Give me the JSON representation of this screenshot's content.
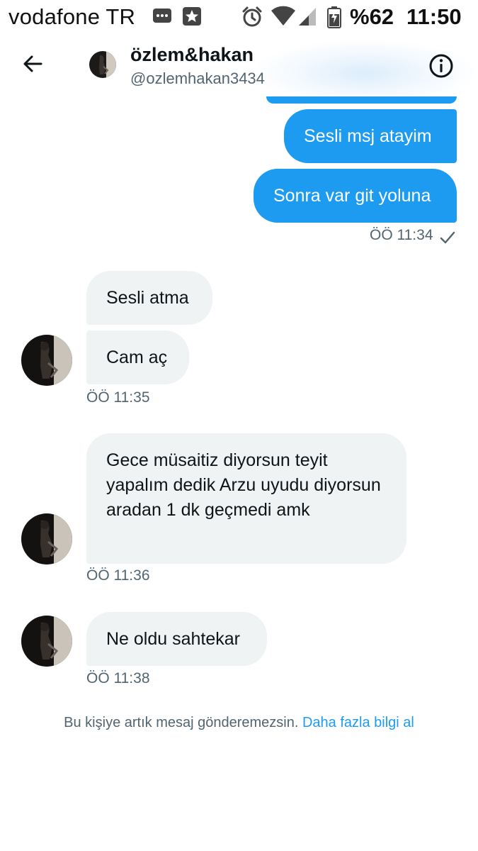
{
  "status_bar": {
    "carrier": "vodafone TR",
    "battery_percent": "%62",
    "time": "11:50",
    "icons": [
      "message-notification-icon",
      "star-app-icon",
      "alarm-icon",
      "wifi-icon",
      "signal-icon",
      "battery-charging-icon"
    ]
  },
  "header": {
    "name": "özlem&hakan",
    "handle": "@ozlemhakan3434",
    "back_icon": "arrow-left-icon",
    "info_icon": "info-icon"
  },
  "messages": {
    "sent": [
      {
        "text": "Sesli msj atayim"
      },
      {
        "text": "Sonra var git yoluna"
      }
    ],
    "sent_time": "ÖÖ 11:34",
    "group1": [
      {
        "text": "Sesli atma"
      },
      {
        "text": "Cam aç"
      }
    ],
    "group1_time": "ÖÖ 11:35",
    "group2": {
      "text": "Gece müsaitiz diyorsun teyit yapalım dedik Arzu uyudu diyorsun aradan 1 dk geçmedi amk"
    },
    "group2_time": "ÖÖ 11:36",
    "group3": {
      "text": "Ne oldu sahtekar"
    },
    "group3_time": "ÖÖ 11:38"
  },
  "footer": {
    "note": "Bu kişiye artık mesaj gönderemezsin.",
    "link": "Daha fazla bilgi al"
  },
  "colors": {
    "accent": "#1d9bf0",
    "received_bubble": "#eff3f4",
    "muted_text": "#536471"
  }
}
